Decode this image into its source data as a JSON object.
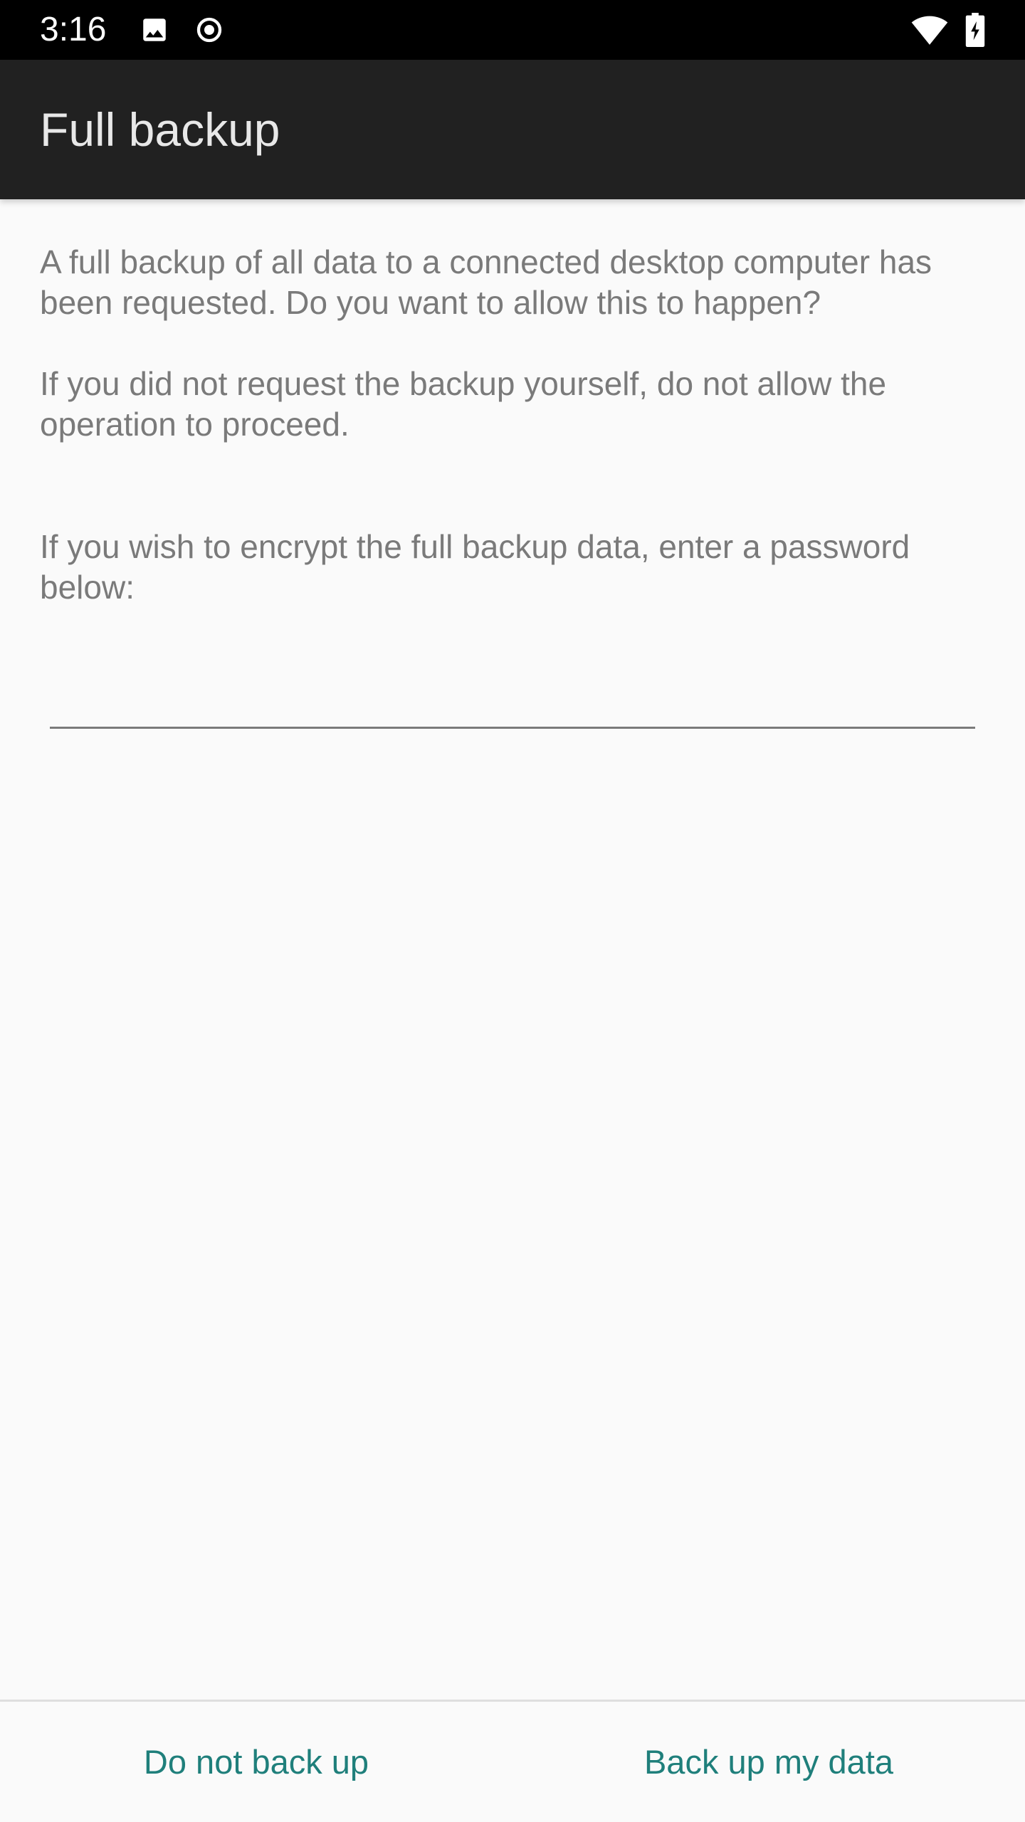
{
  "status_bar": {
    "time": "3:16",
    "icons": [
      "image-icon",
      "record-icon",
      "wifi-icon",
      "battery-charging-icon"
    ]
  },
  "app_bar": {
    "title": "Full backup"
  },
  "content": {
    "paragraph_1": "A full backup of all data to a connected desktop computer has been requested. Do you want to allow this to happen?",
    "paragraph_2": "If you did not request the backup yourself, do not allow the operation to proceed.",
    "paragraph_3": "If you wish to encrypt the full backup data, enter a password below:",
    "password_value": "",
    "password_placeholder": ""
  },
  "buttons": {
    "deny_label": "Do not back up",
    "allow_label": "Back up my data"
  },
  "colors": {
    "status_bar": "#000000",
    "app_bar": "#212121",
    "background": "#fafafa",
    "accent": "#1f7f7b",
    "body_text": "#7a7a7a"
  }
}
